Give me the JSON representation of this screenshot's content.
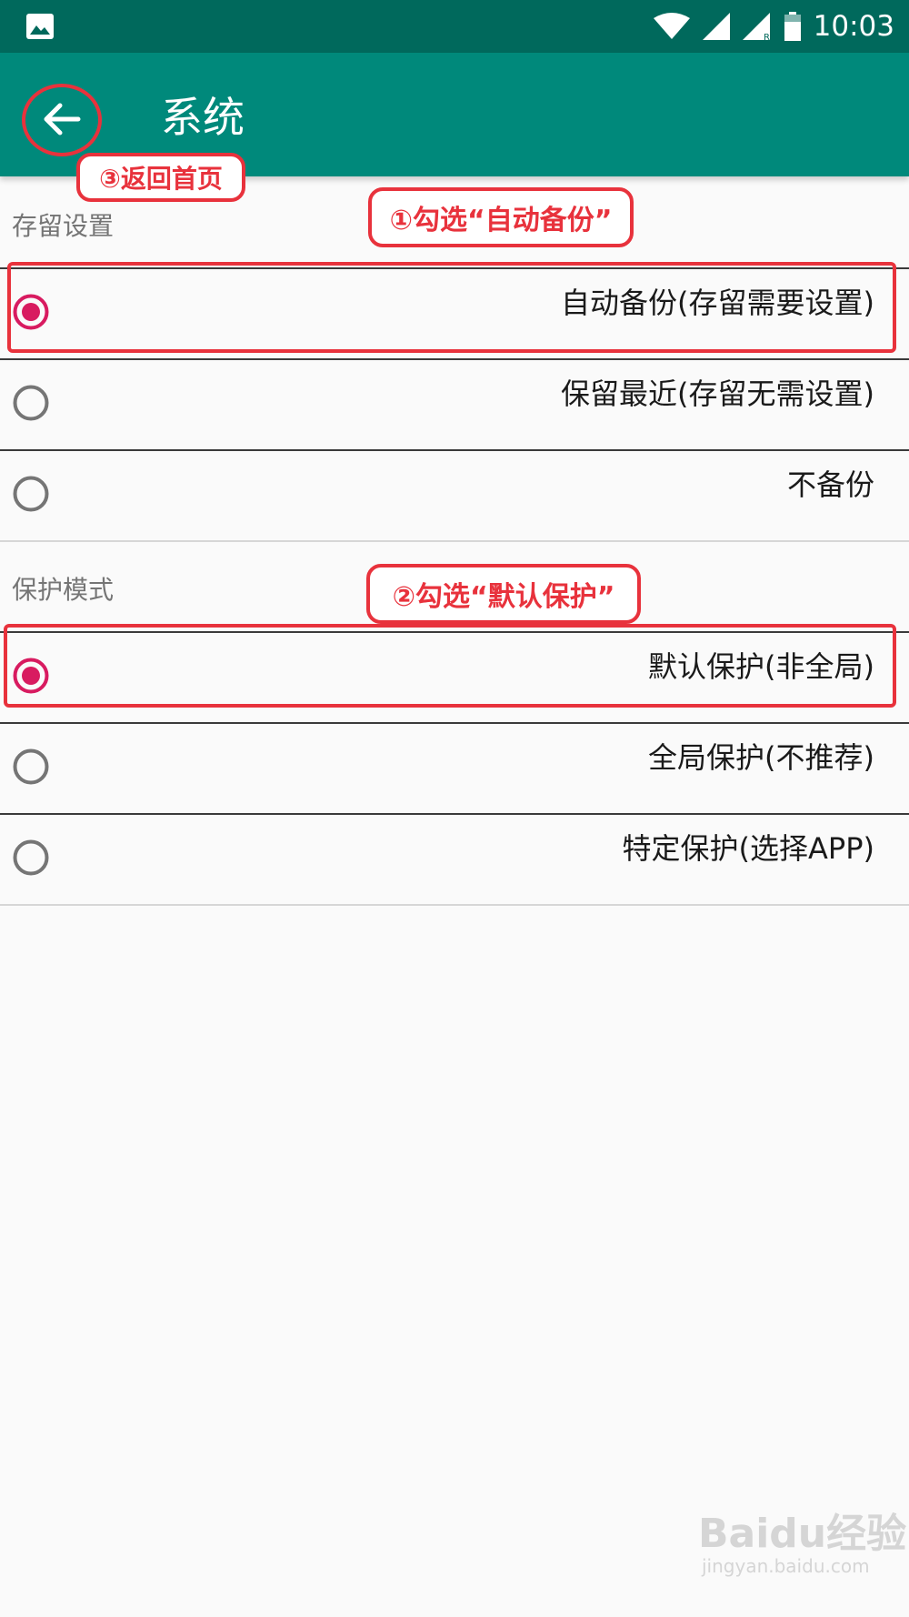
{
  "status_bar": {
    "time": "10:03",
    "icons": [
      "image-icon",
      "wifi-icon",
      "signal-icon",
      "signal-roaming-icon",
      "battery-icon"
    ],
    "roaming_badge": "R"
  },
  "app_bar": {
    "title": "系统",
    "back_icon": "arrow-left-icon"
  },
  "sections": [
    {
      "header": "存留设置",
      "options": [
        {
          "label": "自动备份(存留需要设置)",
          "selected": true
        },
        {
          "label": "保留最近(存留无需设置)",
          "selected": false
        },
        {
          "label": "不备份",
          "selected": false
        }
      ]
    },
    {
      "header": "保护模式",
      "options": [
        {
          "label": "默认保护(非全局)",
          "selected": true
        },
        {
          "label": "全局保护(不推荐)",
          "selected": false
        },
        {
          "label": "特定保护(选择APP)",
          "selected": false
        }
      ]
    }
  ],
  "annotations": {
    "step1": "①勾选“自动备份”",
    "step2": "②勾选“默认保护”",
    "step3": "③返回首页"
  },
  "watermark": {
    "main": "Baidu经验",
    "sub": "jingyan.baidu.com"
  },
  "colors": {
    "status_bar": "#00695c",
    "app_bar": "#00897b",
    "radio_selected": "#d81b60",
    "radio_unselected": "#757575",
    "annotation": "#e8323c"
  }
}
